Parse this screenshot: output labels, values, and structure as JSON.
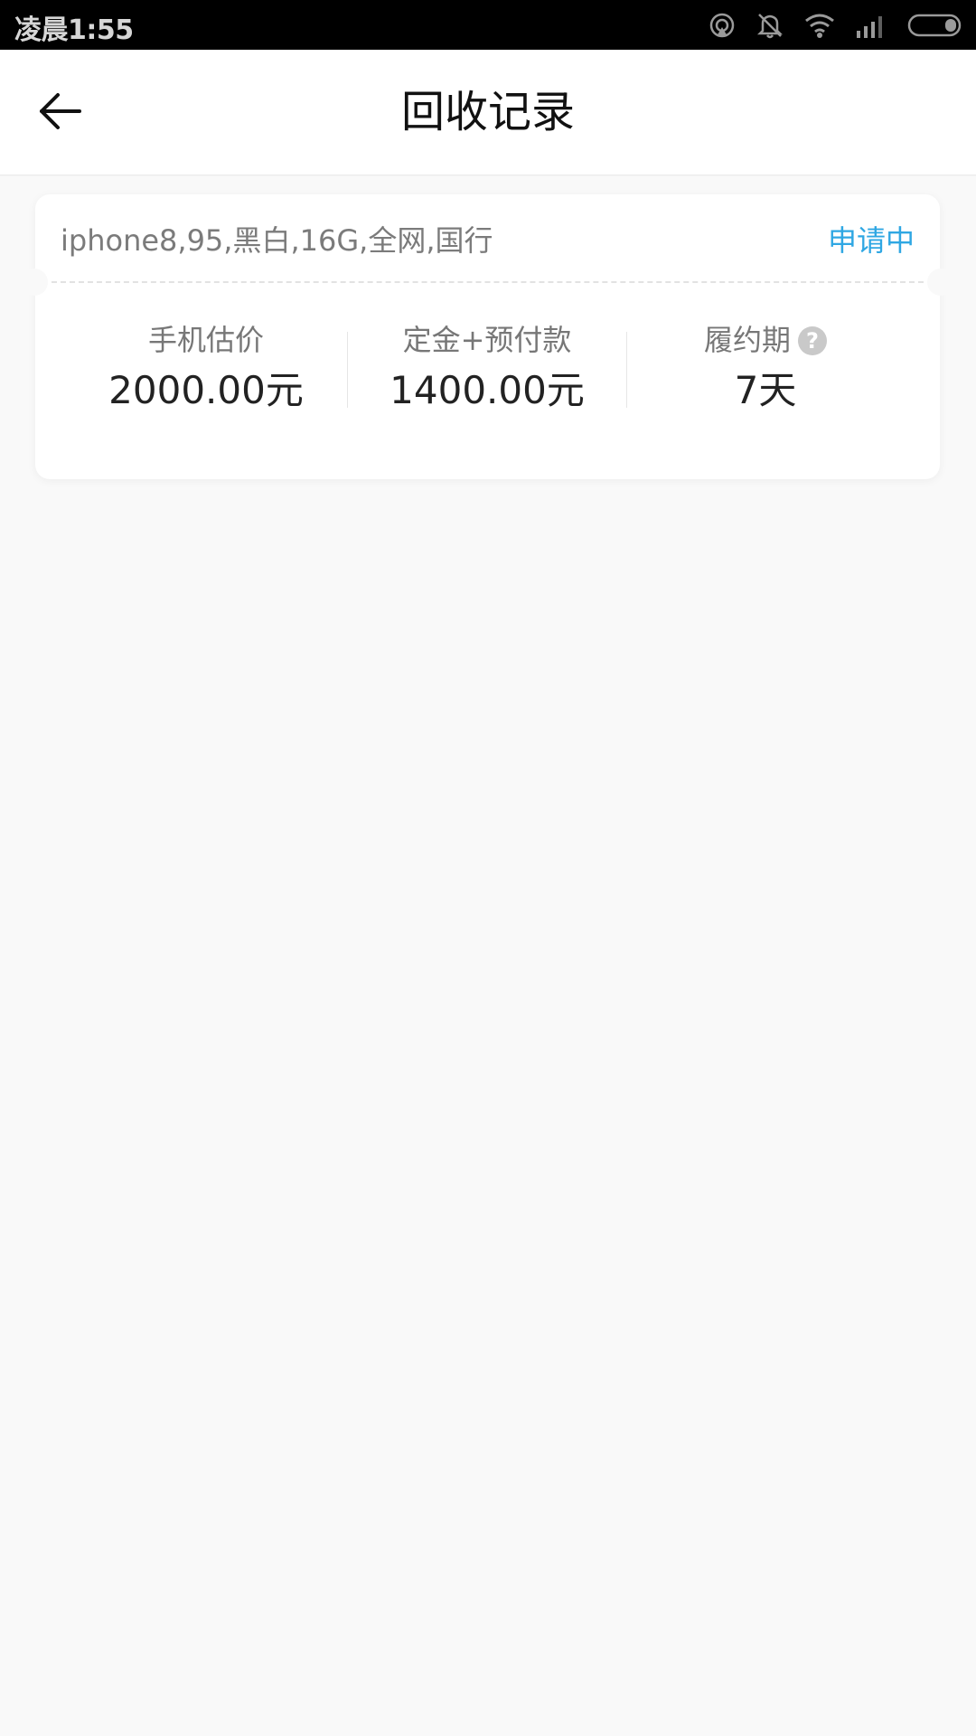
{
  "status_bar": {
    "time": "凌晨1:55",
    "icons": [
      "hotspot-icon",
      "mute-icon",
      "wifi-icon",
      "signal-icon",
      "battery-icon"
    ]
  },
  "header": {
    "back_icon": "arrow-left-icon",
    "title": "回收记录"
  },
  "record": {
    "device": "iphone8,95,黑白,16G,全网,国行",
    "status": "申请中",
    "status_color": "#2fa7e3",
    "stats": [
      {
        "label": "手机估价",
        "value": "2000.00元"
      },
      {
        "label": "定金+预付款",
        "value": "1400.00元"
      },
      {
        "label": "履约期",
        "value": "7天",
        "help_icon": "?"
      }
    ]
  }
}
